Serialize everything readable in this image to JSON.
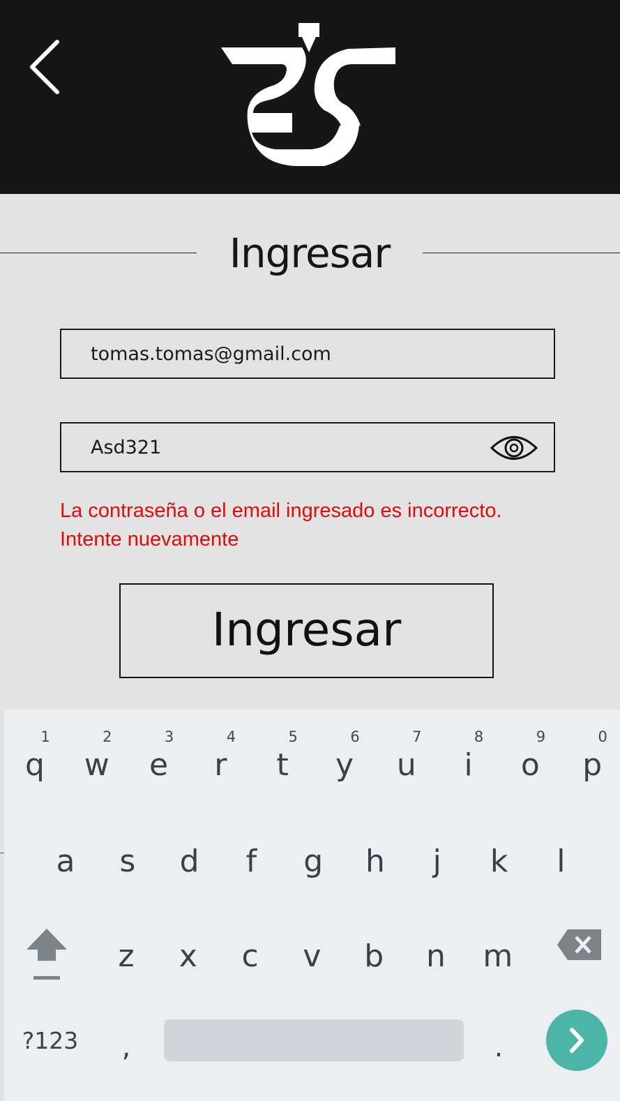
{
  "header": {
    "back_icon": "chevron-left-icon",
    "logo_icon": "brand-logo"
  },
  "title": "Ingresar",
  "form": {
    "email_value": "tomas.tomas@gmail.com",
    "password_value": "Asd321",
    "toggle_icon": "eye-icon",
    "error_line1": "La contraseña o el email ingresado es incorrecto.",
    "error_line2": "Intente nuevamente",
    "submit_label": "Ingresar"
  },
  "keyboard": {
    "row1": [
      {
        "char": "q",
        "hint": "1"
      },
      {
        "char": "w",
        "hint": "2"
      },
      {
        "char": "e",
        "hint": "3"
      },
      {
        "char": "r",
        "hint": "4"
      },
      {
        "char": "t",
        "hint": "5"
      },
      {
        "char": "y",
        "hint": "6"
      },
      {
        "char": "u",
        "hint": "7"
      },
      {
        "char": "i",
        "hint": "8"
      },
      {
        "char": "o",
        "hint": "9"
      },
      {
        "char": "p",
        "hint": "0"
      }
    ],
    "row2": [
      "a",
      "s",
      "d",
      "f",
      "g",
      "h",
      "j",
      "k",
      "l"
    ],
    "row3": [
      "z",
      "x",
      "c",
      "v",
      "b",
      "n",
      "m"
    ],
    "symbols_label": "?123",
    "comma": ",",
    "period": ".",
    "shift_icon": "shift-icon",
    "backspace_icon": "backspace-icon",
    "enter_icon": "chevron-right-icon"
  },
  "colors": {
    "header_bg": "#161616",
    "page_bg": "#e3e3e4",
    "error": "#e10b0b",
    "keyboard_bg": "#eceff2",
    "enter_key": "#4db5a8"
  }
}
